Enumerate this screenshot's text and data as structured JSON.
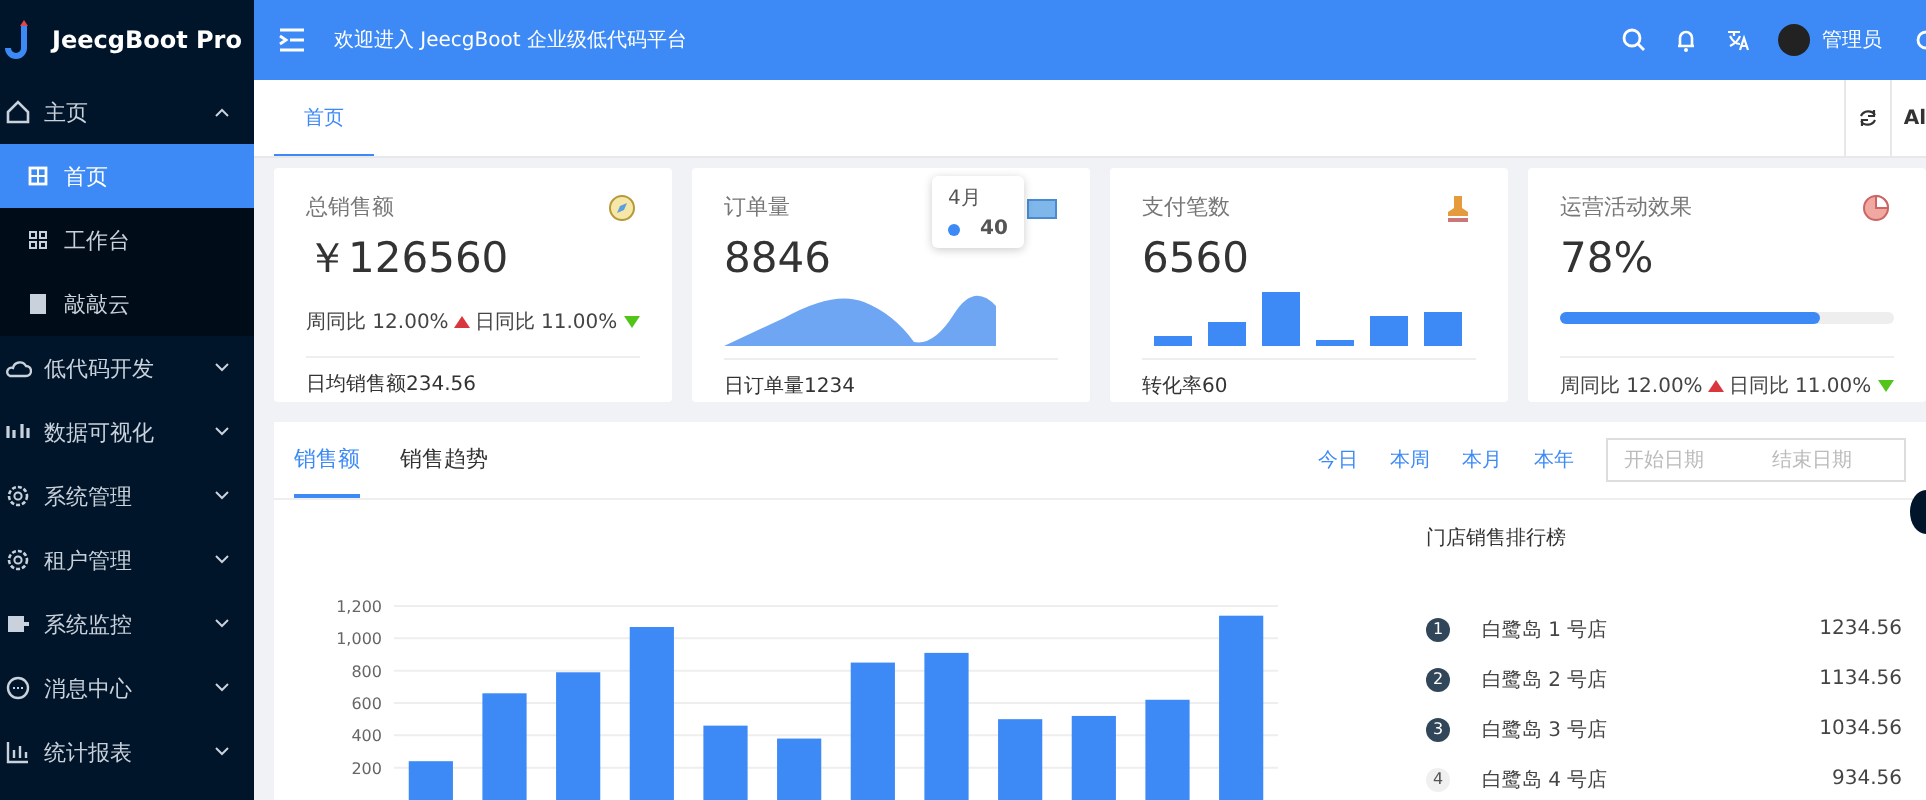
{
  "app": {
    "logo_text": "JeecgBoot Pro"
  },
  "sidebar": {
    "items": [
      {
        "label": "主页",
        "expanded": true,
        "children": [
          {
            "label": "首页",
            "selected": true
          },
          {
            "label": "工作台",
            "selected": false
          },
          {
            "label": "敲敲云",
            "selected": false
          }
        ]
      },
      {
        "label": "低代码开发",
        "expanded": false
      },
      {
        "label": "数据可视化",
        "expanded": false
      },
      {
        "label": "系统管理",
        "expanded": false
      },
      {
        "label": "租户管理",
        "expanded": false
      },
      {
        "label": "系统监控",
        "expanded": false
      },
      {
        "label": "消息中心",
        "expanded": false
      },
      {
        "label": "统计报表",
        "expanded": false
      }
    ]
  },
  "header": {
    "welcome": "欢迎进入 JeecgBoot 企业级低代码平台",
    "user": "管理员"
  },
  "tabs": [
    {
      "label": "首页",
      "selected": true
    }
  ],
  "tab_bar_extra": "Al",
  "cards": [
    {
      "kind": "trend",
      "title": "总销售额",
      "value": "￥126560",
      "trends": [
        {
          "label": "周同比 12.00%",
          "increase": true
        },
        {
          "label": "日同比 11.00%",
          "increase": false
        }
      ],
      "footer": "日均销售额234.56"
    },
    {
      "kind": "area",
      "title": "订单量",
      "value": "8846",
      "tooltip": {
        "title": "4月",
        "value": "40"
      },
      "footer": "日订单量1234"
    },
    {
      "kind": "bars",
      "title": "支付笔数",
      "value": "6560",
      "footer": "转化率60"
    },
    {
      "kind": "progress",
      "title": "运营活动效果",
      "value": "78%",
      "level": 0.78,
      "trends": [
        {
          "label": "周同比 12.00%",
          "increase": true
        },
        {
          "label": "日同比 11.00%",
          "increase": false
        }
      ]
    }
  ],
  "sales": {
    "tabs": [
      {
        "label": "销售额",
        "selected": true
      },
      {
        "label": "销售趋势",
        "selected": false
      }
    ],
    "ranges": [
      "今日",
      "本周",
      "本月",
      "本年"
    ],
    "date_range": {
      "start_placeholder": "开始日期",
      "end_placeholder": "结束日期"
    },
    "chart_data": {
      "type": "bar",
      "ylim": [
        0,
        1200
      ],
      "grid": true,
      "values": [
        240,
        660,
        790,
        1070,
        460,
        380,
        850,
        910,
        500,
        520,
        620,
        1140
      ],
      "yticks": [
        {
          "value": 200,
          "label": "200"
        },
        {
          "value": 400,
          "label": "400"
        },
        {
          "value": 600,
          "label": "600"
        },
        {
          "value": 800,
          "label": "800"
        },
        {
          "value": 1000,
          "label": "1,000"
        },
        {
          "value": 1200,
          "label": "1,200"
        }
      ]
    },
    "ranking": {
      "title": "门店销售排行榜",
      "rows": [
        {
          "rank": "1",
          "name": "白鹭岛 1 号店",
          "amount": "1234.56",
          "highlighted": true
        },
        {
          "rank": "2",
          "name": "白鹭岛 2 号店",
          "amount": "1134.56",
          "highlighted": true
        },
        {
          "rank": "3",
          "name": "白鹭岛 3 号店",
          "amount": "1034.56",
          "highlighted": true
        },
        {
          "rank": "4",
          "name": "白鹭岛 4 号店",
          "amount": "934.56",
          "highlighted": false
        }
      ]
    }
  }
}
